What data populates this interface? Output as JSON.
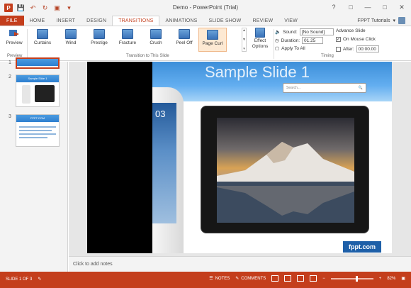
{
  "app": {
    "window_title": "Demo - PowerPoint (Trial)",
    "account": "FPPT Tutorials",
    "logo_text": "P"
  },
  "tabs": [
    "FILE",
    "HOME",
    "INSERT",
    "DESIGN",
    "TRANSITIONS",
    "ANIMATIONS",
    "SLIDE SHOW",
    "REVIEW",
    "VIEW"
  ],
  "active_tab": "TRANSITIONS",
  "ribbon": {
    "preview": {
      "label": "Preview",
      "group_label": "Preview"
    },
    "gallery": [
      "Curtains",
      "Wind",
      "Prestige",
      "Fracture",
      "Crush",
      "Peel Off",
      "Page Curl"
    ],
    "highlighted": "Page Curl",
    "group_label": "Transition to This Slide",
    "effect_options": {
      "line1": "Effect",
      "line2": "Options"
    },
    "timing": {
      "sound_label": "Sound:",
      "sound_value": "[No Sound]",
      "duration_label": "Duration:",
      "duration_value": "01.25",
      "apply_all": "Apply To All",
      "advance_label": "Advance Slide",
      "on_click_label": "On Mouse Click",
      "on_click_checked": true,
      "after_label": "After:",
      "after_value": "00:00.00",
      "group_label": "Timing"
    }
  },
  "thumbnails": [
    {
      "num": "1",
      "title": "",
      "selected": true
    },
    {
      "num": "2",
      "title": "Sample Slide 1",
      "selected": false
    },
    {
      "num": "3",
      "title": "FPPT.COM",
      "selected": false
    }
  ],
  "slide": {
    "title": "Sample Slide 1",
    "search_placeholder": "Search...",
    "phone_time": "03",
    "badge": "fppt.com"
  },
  "notes_placeholder": "Click to add notes",
  "status": {
    "slide_info": "SLIDE 1 OF 3",
    "notes": "NOTES",
    "comments": "COMMENTS",
    "zoom": "82%",
    "zoom_fraction": 0.62
  },
  "colors": {
    "accent": "#c43e1c",
    "ribbon_highlight": "#fde9d3"
  }
}
